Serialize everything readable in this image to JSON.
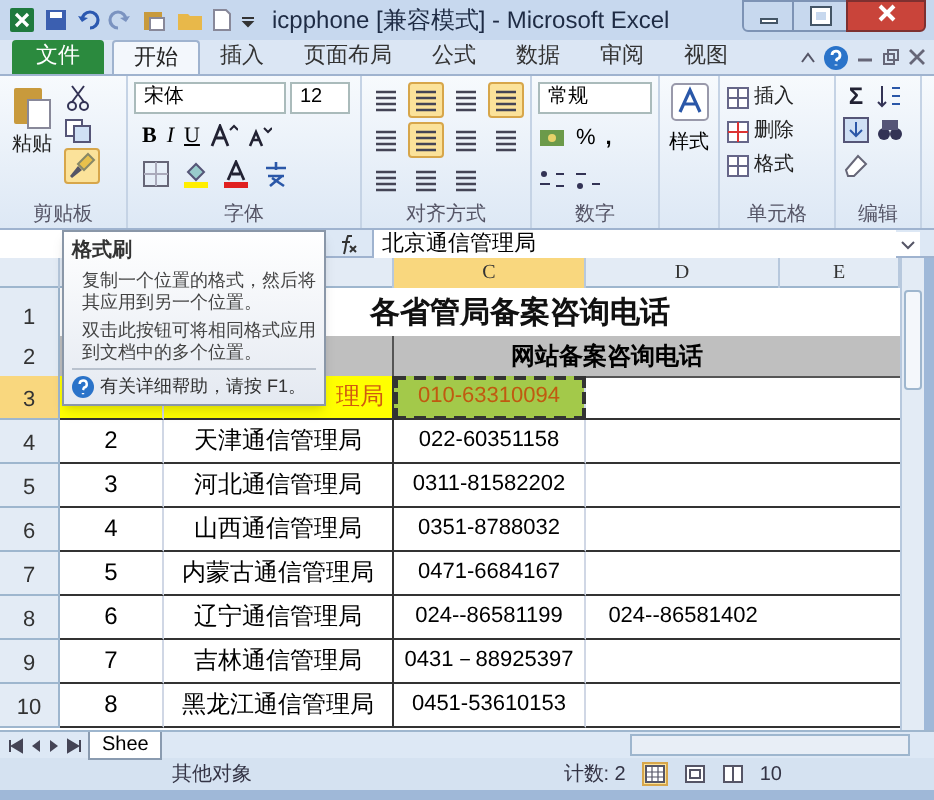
{
  "window": {
    "title": "icpphone  [兼容模式]  -  Microsoft Excel"
  },
  "ribbon_tabs": [
    {
      "label": "文件",
      "kind": "file",
      "selected": false
    },
    {
      "label": "开始",
      "kind": "tab",
      "selected": true
    },
    {
      "label": "插入",
      "kind": "tab",
      "selected": false
    },
    {
      "label": "页面布局",
      "kind": "tab",
      "selected": false
    },
    {
      "label": "公式",
      "kind": "tab",
      "selected": false
    },
    {
      "label": "数据",
      "kind": "tab",
      "selected": false
    },
    {
      "label": "审阅",
      "kind": "tab",
      "selected": false
    },
    {
      "label": "视图",
      "kind": "tab",
      "selected": false
    }
  ],
  "ribbon": {
    "paste": "粘贴",
    "font_name": "宋体",
    "font_size": "12",
    "bold": "B",
    "italic": "I",
    "underline": "U",
    "number_format": "常规",
    "percent": "%",
    "comma": ",",
    "styles": "样式",
    "cells": [
      "插入",
      "删除",
      "格式"
    ],
    "sum": "Σ",
    "groups": [
      "剪贴板",
      "字体",
      "对齐方式",
      "数字",
      "单元格",
      "编辑"
    ]
  },
  "formula_bar": {
    "value": "北京通信管理局"
  },
  "column_headers": [
    {
      "label": "C",
      "selected": true
    },
    {
      "label": "D",
      "selected": false
    },
    {
      "label": "E",
      "selected": false
    }
  ],
  "rows": [
    {
      "number": "1",
      "kind": "title",
      "selected": false,
      "text": "各省管局备案咨询电话"
    },
    {
      "number": "2",
      "kind": "header",
      "selected": false,
      "text": "网站备案咨询电话"
    },
    {
      "number": "3",
      "kind": "data",
      "selected": true,
      "cells": [
        "",
        "理局",
        "010-63310094",
        ""
      ]
    },
    {
      "number": "4",
      "kind": "data",
      "selected": false,
      "cells": [
        "2",
        "天津通信管理局",
        "022-60351158",
        ""
      ]
    },
    {
      "number": "5",
      "kind": "data",
      "selected": false,
      "cells": [
        "3",
        "河北通信管理局",
        "0311-81582202",
        ""
      ]
    },
    {
      "number": "6",
      "kind": "data",
      "selected": false,
      "cells": [
        "4",
        "山西通信管理局",
        "0351-8788032",
        ""
      ]
    },
    {
      "number": "7",
      "kind": "data",
      "selected": false,
      "cells": [
        "5",
        "内蒙古通信管理局",
        "0471-6684167",
        ""
      ]
    },
    {
      "number": "8",
      "kind": "data",
      "selected": false,
      "cells": [
        "6",
        "辽宁通信管理局",
        "024--86581199",
        "024--86581402"
      ]
    },
    {
      "number": "9",
      "kind": "data",
      "selected": false,
      "cells": [
        "7",
        "吉林通信管理局",
        "0431－88925397",
        ""
      ]
    },
    {
      "number": "10",
      "kind": "data",
      "selected": false,
      "cells": [
        "8",
        "黑龙江通信管理局",
        "0451-53610153",
        ""
      ]
    }
  ],
  "tooltip": {
    "title": "格式刷",
    "paragraphs": [
      "复制一个位置的格式，然后将其应用到另一个位置。",
      "双击此按钮可将相同格式应用到文档中的多个位置。"
    ],
    "help": "有关详细帮助，请按 F1。"
  },
  "sheet_tabs": [
    {
      "label": "Shee",
      "selected": true
    }
  ],
  "status_bar": {
    "message": "其他对象",
    "count": "计数: 2",
    "zoom": "10"
  }
}
